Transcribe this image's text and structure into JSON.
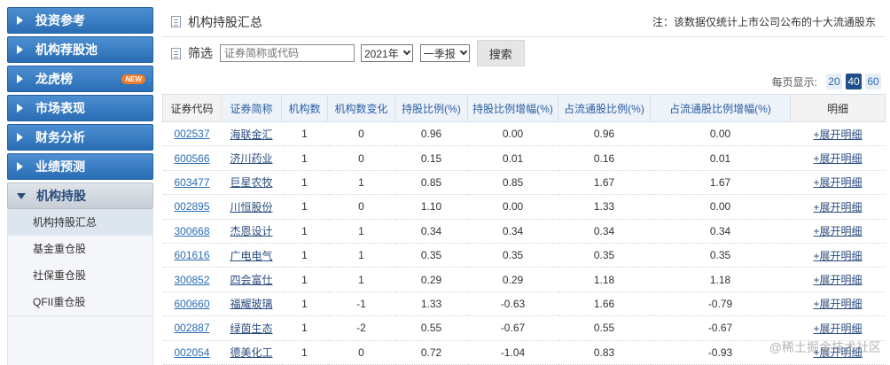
{
  "sidebar": {
    "items": [
      {
        "label": "投资参考"
      },
      {
        "label": "机构荐股池"
      },
      {
        "label": "龙虎榜",
        "badge": "NEW"
      },
      {
        "label": "市场表现"
      },
      {
        "label": "财务分析"
      },
      {
        "label": "业绩预测"
      },
      {
        "label": "机构持股"
      }
    ],
    "sub_items": [
      {
        "label": "机构持股汇总"
      },
      {
        "label": "基金重仓股"
      },
      {
        "label": "社保重仓股"
      },
      {
        "label": "QFII重仓股"
      }
    ]
  },
  "header": {
    "title": "机构持股汇总",
    "note": "注：该数据仅统计上市公司公布的十大流通股东"
  },
  "filter": {
    "label": "筛选",
    "search_placeholder": "证券简称或代码",
    "year": "2021年",
    "quarter": "一季报",
    "search_button": "搜索"
  },
  "perpage": {
    "label": "每页显示:",
    "options": [
      "20",
      "40",
      "60"
    ],
    "selected": "40"
  },
  "table": {
    "headers": [
      "证券代码",
      "证券简称",
      "机构数",
      "机构数变化",
      "持股比例(%)",
      "持股比例增幅(%)",
      "占流通股比例(%)",
      "占流通股比例增幅(%)",
      "明细"
    ],
    "detail_label": "+展开明细",
    "rows": [
      {
        "code": "002537",
        "name": "海联金汇",
        "inst": "1",
        "inst_change": "0",
        "hold": "0.96",
        "hold_inc": "0.00",
        "float": "0.96",
        "float_inc": "0.00"
      },
      {
        "code": "600566",
        "name": "济川药业",
        "inst": "1",
        "inst_change": "0",
        "hold": "0.15",
        "hold_inc": "0.01",
        "float": "0.16",
        "float_inc": "0.01"
      },
      {
        "code": "603477",
        "name": "巨星农牧",
        "inst": "1",
        "inst_change": "1",
        "hold": "0.85",
        "hold_inc": "0.85",
        "float": "1.67",
        "float_inc": "1.67"
      },
      {
        "code": "002895",
        "name": "川恒股份",
        "inst": "1",
        "inst_change": "0",
        "hold": "1.10",
        "hold_inc": "0.00",
        "float": "1.33",
        "float_inc": "0.00"
      },
      {
        "code": "300668",
        "name": "杰恩设计",
        "inst": "1",
        "inst_change": "1",
        "hold": "0.34",
        "hold_inc": "0.34",
        "float": "0.34",
        "float_inc": "0.34"
      },
      {
        "code": "601616",
        "name": "广电电气",
        "inst": "1",
        "inst_change": "1",
        "hold": "0.35",
        "hold_inc": "0.35",
        "float": "0.35",
        "float_inc": "0.35"
      },
      {
        "code": "300852",
        "name": "四会富仕",
        "inst": "1",
        "inst_change": "1",
        "hold": "0.29",
        "hold_inc": "0.29",
        "float": "1.18",
        "float_inc": "1.18"
      },
      {
        "code": "600660",
        "name": "福耀玻璃",
        "inst": "1",
        "inst_change": "-1",
        "hold": "1.33",
        "hold_inc": "-0.63",
        "float": "1.66",
        "float_inc": "-0.79"
      },
      {
        "code": "002887",
        "name": "绿茵生态",
        "inst": "1",
        "inst_change": "-2",
        "hold": "0.55",
        "hold_inc": "-0.67",
        "float": "0.55",
        "float_inc": "-0.67"
      },
      {
        "code": "002054",
        "name": "德美化工",
        "inst": "1",
        "inst_change": "0",
        "hold": "0.72",
        "hold_inc": "-1.04",
        "float": "0.83",
        "float_inc": "-0.93"
      }
    ]
  },
  "watermark": "@稀土掘金技术社区"
}
